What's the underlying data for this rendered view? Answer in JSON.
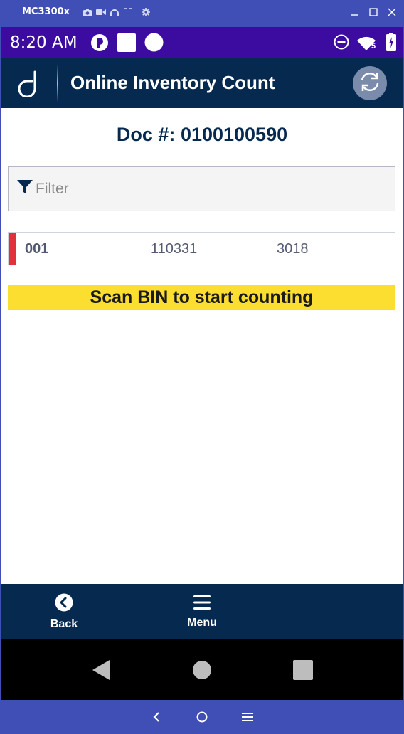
{
  "emulator": {
    "device_name": "MC3300x",
    "toolbar_icons": [
      "camera-icon",
      "video-icon",
      "headset-icon",
      "fullscreen-icon",
      "settings-icon"
    ],
    "window_controls": [
      "minimize-icon",
      "maximize-icon",
      "close-icon"
    ],
    "bottom_controls": [
      "back-chevron-icon",
      "home-circle-icon",
      "menu-lines-icon"
    ]
  },
  "status_bar": {
    "time": "8:20 AM",
    "left_icons": [
      "notification-app-icon",
      "square-notification-icon",
      "circle-notification-icon"
    ],
    "right_icons": [
      "do-not-disturb-icon",
      "wifi-icon",
      "battery-charging-icon"
    ],
    "wifi_badge": "5"
  },
  "header": {
    "title": "Online Inventory Count",
    "logo_icon": "d-logo-icon",
    "sync_icon": "sync-icon"
  },
  "document": {
    "label": "Doc #:",
    "number": "0100100590"
  },
  "filter": {
    "placeholder": "Filter",
    "value": "",
    "icon": "filter-funnel-icon"
  },
  "rows": [
    {
      "col1": "001",
      "col2": "110331",
      "col3": "3018",
      "marker_color": "#e0313f"
    }
  ],
  "banner": {
    "text": "Scan BIN to start counting",
    "color": "#fcde30"
  },
  "bottom_nav": {
    "back_label": "Back",
    "menu_label": "Menu"
  },
  "colors": {
    "header_bg": "#062a4f",
    "status_bar_bg": "#3c0ca0",
    "emulator_bg": "#3f4fb5"
  }
}
